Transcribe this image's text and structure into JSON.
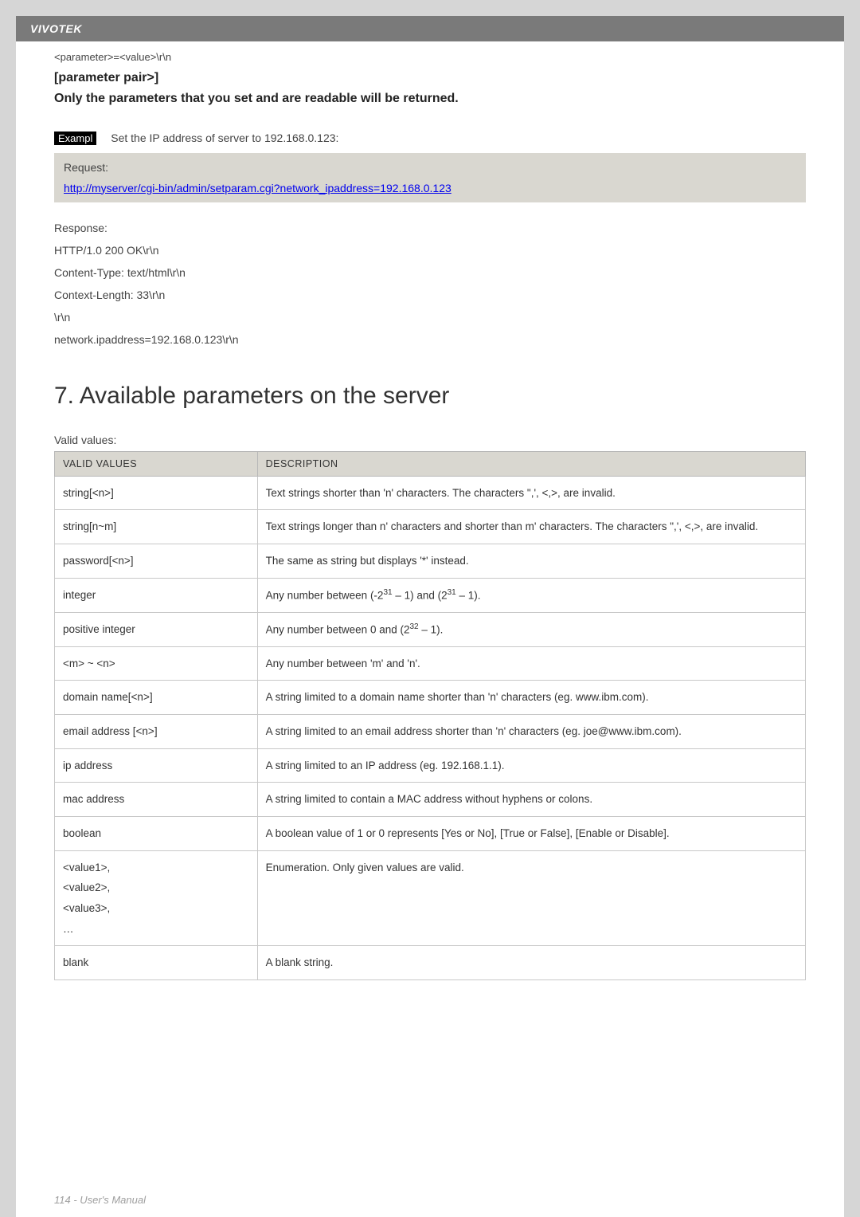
{
  "header": {
    "brand": "VIVOTEK"
  },
  "preamble": {
    "line": "<parameter>=<value>\\r\\n",
    "param_pair": "[parameter pair>]",
    "only_line": "Only the parameters that you set and are readable will be returned."
  },
  "example": {
    "label": "Exampl",
    "desc": "Set the IP address of server to 192.168.0.123:",
    "request_label": "Request:",
    "request_url": "http://myserver/cgi-bin/admin/setparam.cgi?network_ipaddress=192.168.0.123",
    "response": {
      "label": "Response:",
      "lines": [
        "HTTP/1.0 200 OK\\r\\n",
        "Content-Type: text/html\\r\\n",
        "Context-Length: 33\\r\\n",
        "\\r\\n",
        "network.ipaddress=192.168.0.123\\r\\n"
      ]
    }
  },
  "section": {
    "title": "7. Available parameters on the server",
    "valid_label": "Valid values:"
  },
  "table": {
    "headers": {
      "col1": "VALID VALUES",
      "col2": "DESCRIPTION"
    },
    "rows": [
      {
        "v": "string[<n>]",
        "d": "Text strings shorter than 'n' characters. The characters \",', <,>, are invalid."
      },
      {
        "v": "string[n~m]",
        "d": "Text strings longer than n' characters and shorter than m' characters. The characters \",', <,>, are invalid."
      },
      {
        "v": "password[<n>]",
        "d": "The same as string but displays '*' instead."
      },
      {
        "v": "integer",
        "d_html": "Any number between (-2<span class='sup'>31</span> – 1) and (2<span class='sup'>31</span> – 1)."
      },
      {
        "v": "positive integer",
        "d_html": "Any number between 0 and (2<span class='sup'>32</span> – 1)."
      },
      {
        "v": "<m> ~ <n>",
        "d": "Any number between 'm' and 'n'."
      },
      {
        "v": "domain name[<n>]",
        "d": "A string limited to a domain name shorter than 'n' characters (eg. www.ibm.com)."
      },
      {
        "v": "email address [<n>]",
        "d": "A string limited to an email address shorter than 'n' characters (eg. joe@www.ibm.com)."
      },
      {
        "v": "ip address",
        "d": "A string limited to an IP address (eg. 192.168.1.1)."
      },
      {
        "v": "mac address",
        "d": "A string limited to contain a MAC address without hyphens or colons."
      },
      {
        "v": "boolean",
        "d": "A boolean value of 1 or 0 represents [Yes or No], [True or False], [Enable or Disable]."
      },
      {
        "v_html": "&lt;value1&gt;,<br>&lt;value2&gt;,<br>&lt;value3&gt;,<br>…",
        "d": "Enumeration. Only given values are valid."
      },
      {
        "v": "blank",
        "d": "A blank string."
      }
    ]
  },
  "footer": {
    "text": "114 - User's Manual"
  }
}
